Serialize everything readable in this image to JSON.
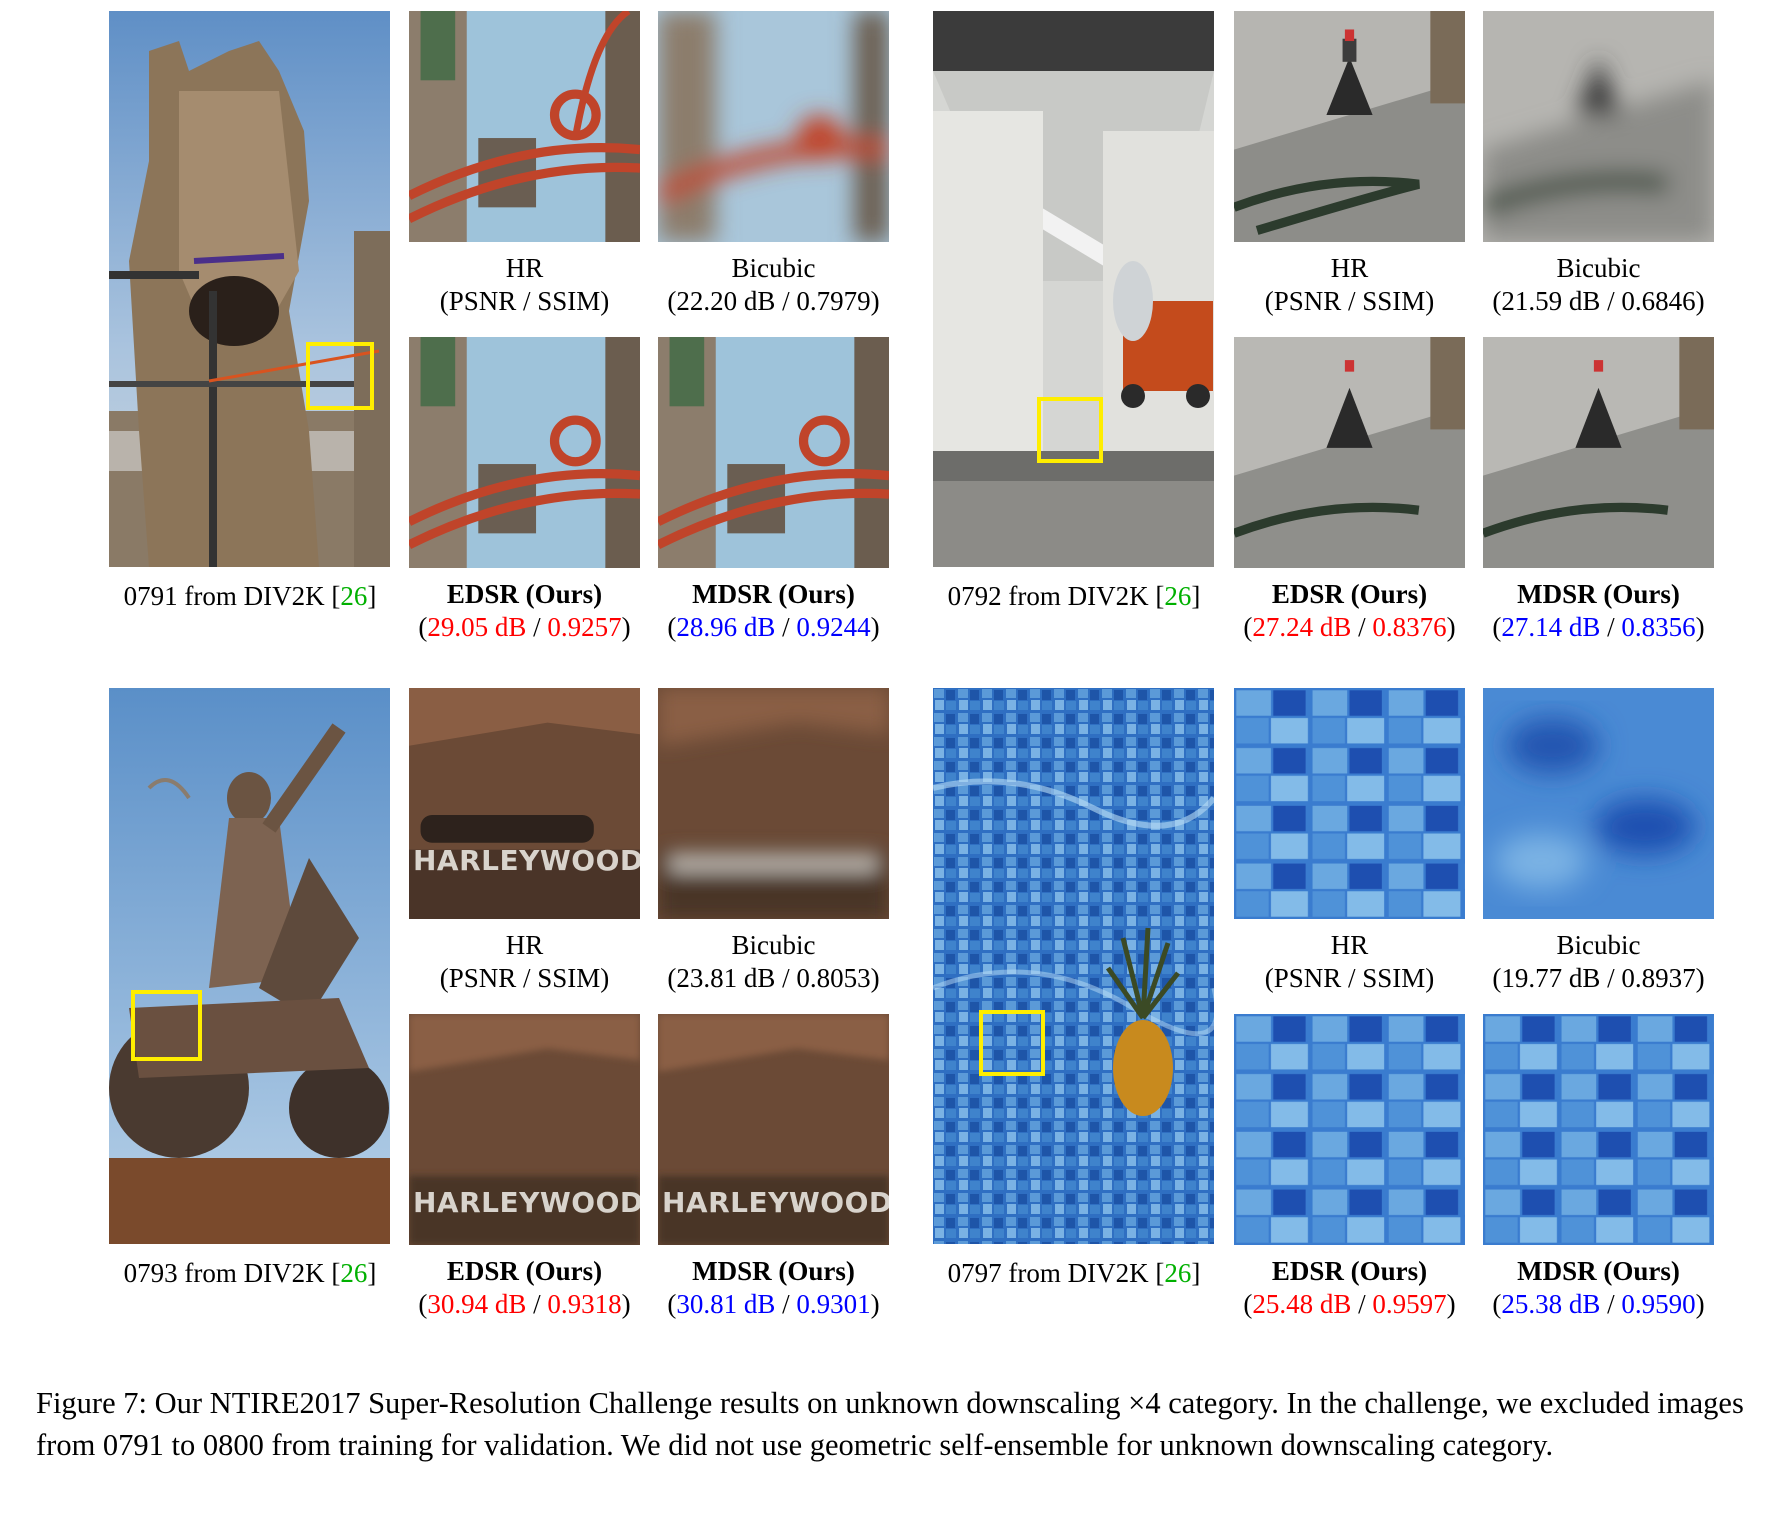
{
  "panels": [
    {
      "id": "0791",
      "source_label": "0791 from DIV2K",
      "ref_num": "26",
      "hr_label": "HR",
      "hr_sub": "(PSNR / SSIM)",
      "bicubic_label": "Bicubic",
      "bicubic_sub": "(22.20 dB / 0.7979)",
      "edsr_label": "EDSR (Ours)",
      "edsr_psnr": "29.05 dB",
      "edsr_ssim": "0.9257",
      "mdsr_label": "MDSR (Ours)",
      "mdsr_psnr": "28.96 dB",
      "mdsr_ssim": "0.9244"
    },
    {
      "id": "0792",
      "source_label": "0792 from DIV2K",
      "ref_num": "26",
      "hr_label": "HR",
      "hr_sub": "(PSNR / SSIM)",
      "bicubic_label": "Bicubic",
      "bicubic_sub": "(21.59 dB / 0.6846)",
      "edsr_label": "EDSR (Ours)",
      "edsr_psnr": "27.24 dB",
      "edsr_ssim": "0.8376",
      "mdsr_label": "MDSR (Ours)",
      "mdsr_psnr": "27.14 dB",
      "mdsr_ssim": "0.8356"
    },
    {
      "id": "0793",
      "source_label": "0793 from DIV2K",
      "ref_num": "26",
      "hr_label": "HR",
      "hr_sub": "(PSNR / SSIM)",
      "bicubic_label": "Bicubic",
      "bicubic_sub": "(23.81 dB / 0.8053)",
      "edsr_label": "EDSR (Ours)",
      "edsr_psnr": "30.94 dB",
      "edsr_ssim": "0.9318",
      "mdsr_label": "MDSR (Ours)",
      "mdsr_psnr": "30.81 dB",
      "mdsr_ssim": "0.9301",
      "crop_text": "HARLEYWOOD"
    },
    {
      "id": "0797",
      "source_label": "0797 from DIV2K",
      "ref_num": "26",
      "hr_label": "HR",
      "hr_sub": "(PSNR / SSIM)",
      "bicubic_label": "Bicubic",
      "bicubic_sub": "(19.77 dB / 0.8937)",
      "edsr_label": "EDSR (Ours)",
      "edsr_psnr": "25.48 dB",
      "edsr_ssim": "0.9597",
      "mdsr_label": "MDSR (Ours)",
      "mdsr_psnr": "25.38 dB",
      "mdsr_ssim": "0.9590"
    }
  ],
  "caption": "Figure 7: Our NTIRE2017 Super-Resolution Challenge results on unknown downscaling ×4 category. In the challenge, we excluded images from 0791 to 0800 from training for validation. We did not use geometric self-ensemble for unknown downscaling category.",
  "colors": {
    "best": "#ff0000",
    "second": "#0000ff",
    "citation": "#00b000",
    "zoom_box": "#ffee00"
  }
}
